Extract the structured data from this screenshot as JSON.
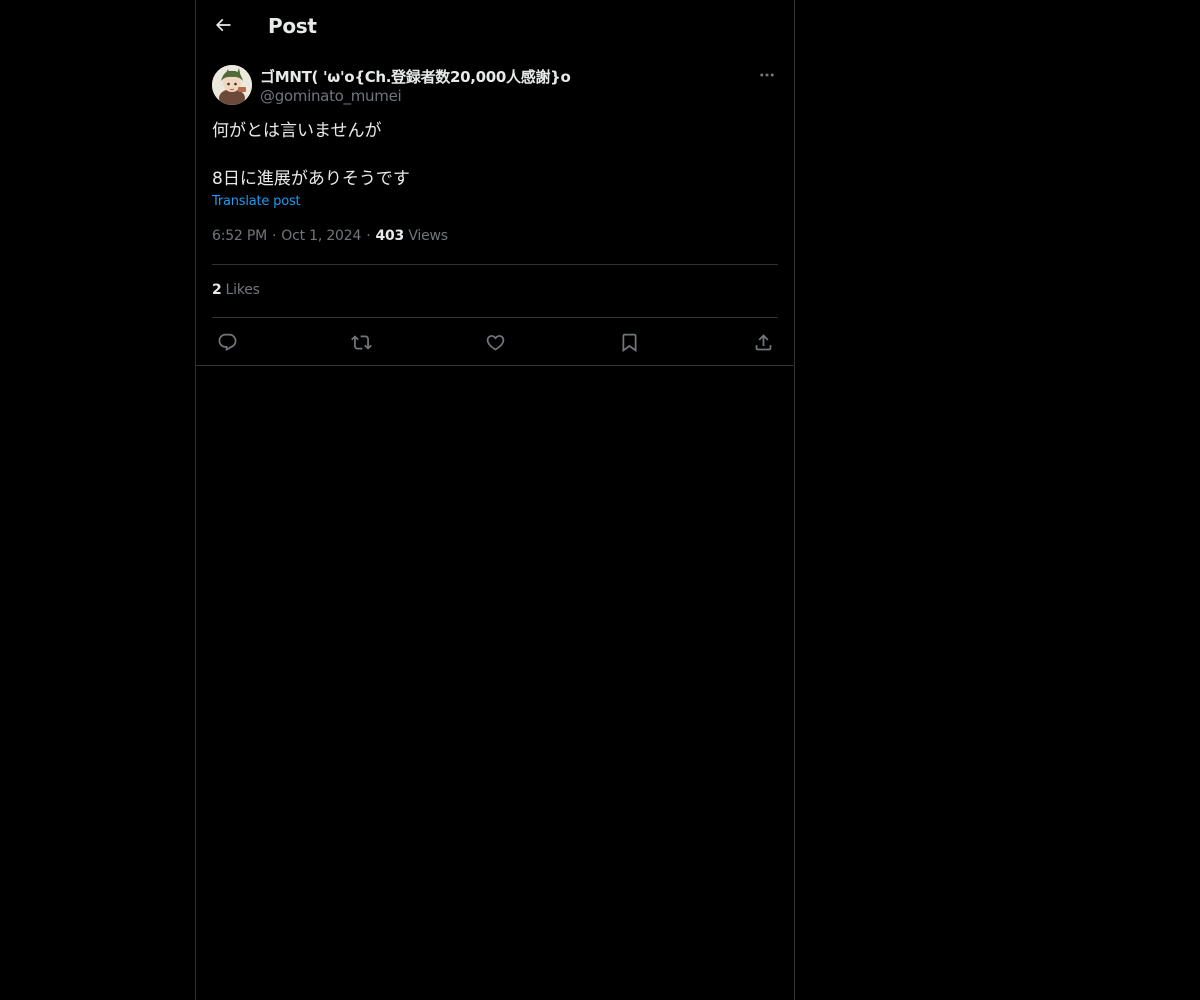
{
  "header": {
    "title": "Post",
    "back_icon": "arrow-left-icon"
  },
  "author": {
    "display_name": "ゴMNT( 'ω'o{Ch.登録者数20,000人感謝}o",
    "handle": "@gominato_mumei",
    "more_icon": "more-horizontal-icon"
  },
  "post": {
    "lines": [
      "何がとは言いませんが",
      "",
      "8日に進展がありそうです"
    ],
    "translate_label": "Translate post"
  },
  "meta": {
    "time": "6:52 PM",
    "separator": "·",
    "date": "Oct 1, 2024",
    "views_count": "403",
    "views_label": "Views"
  },
  "stats": {
    "likes_count": "2",
    "likes_label": "Likes"
  },
  "actions": [
    {
      "name": "reply",
      "icon": "reply-icon"
    },
    {
      "name": "repost",
      "icon": "repost-icon"
    },
    {
      "name": "like",
      "icon": "heart-icon"
    },
    {
      "name": "bookmark",
      "icon": "bookmark-icon"
    },
    {
      "name": "share",
      "icon": "share-icon"
    }
  ],
  "colors": {
    "background": "#000000",
    "text": "#e7e9ea",
    "secondary_text": "#71767b",
    "link": "#1d9bf0",
    "border": "#2f3336"
  }
}
